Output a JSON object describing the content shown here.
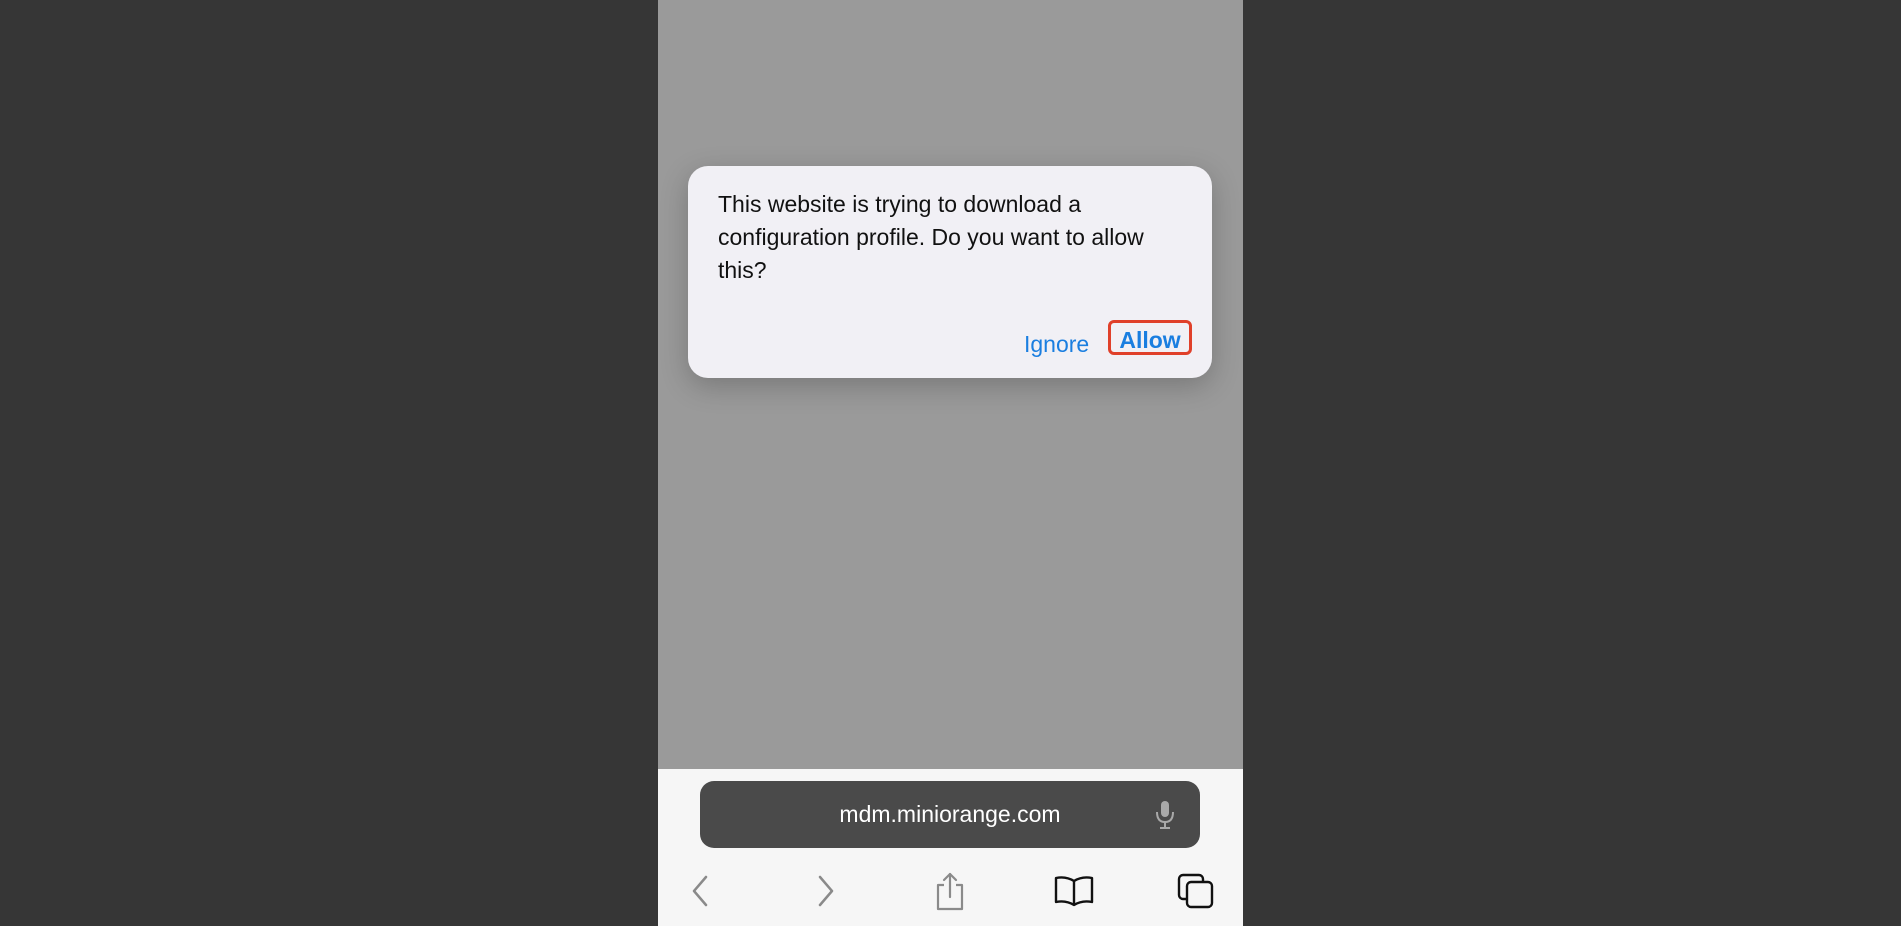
{
  "alert": {
    "message": "This website is trying to download a configuration profile. Do you want to allow this?",
    "ignore_label": "Ignore",
    "allow_label": "Allow"
  },
  "address_bar": {
    "url": "mdm.miniorange.com",
    "mic_icon": "microphone-icon"
  },
  "toolbar": {
    "items": [
      "back-icon",
      "forward-icon",
      "share-icon",
      "bookmarks-icon",
      "tabs-icon"
    ]
  },
  "colors": {
    "accent": "#1a7ee0",
    "highlight": "#e0402a"
  }
}
